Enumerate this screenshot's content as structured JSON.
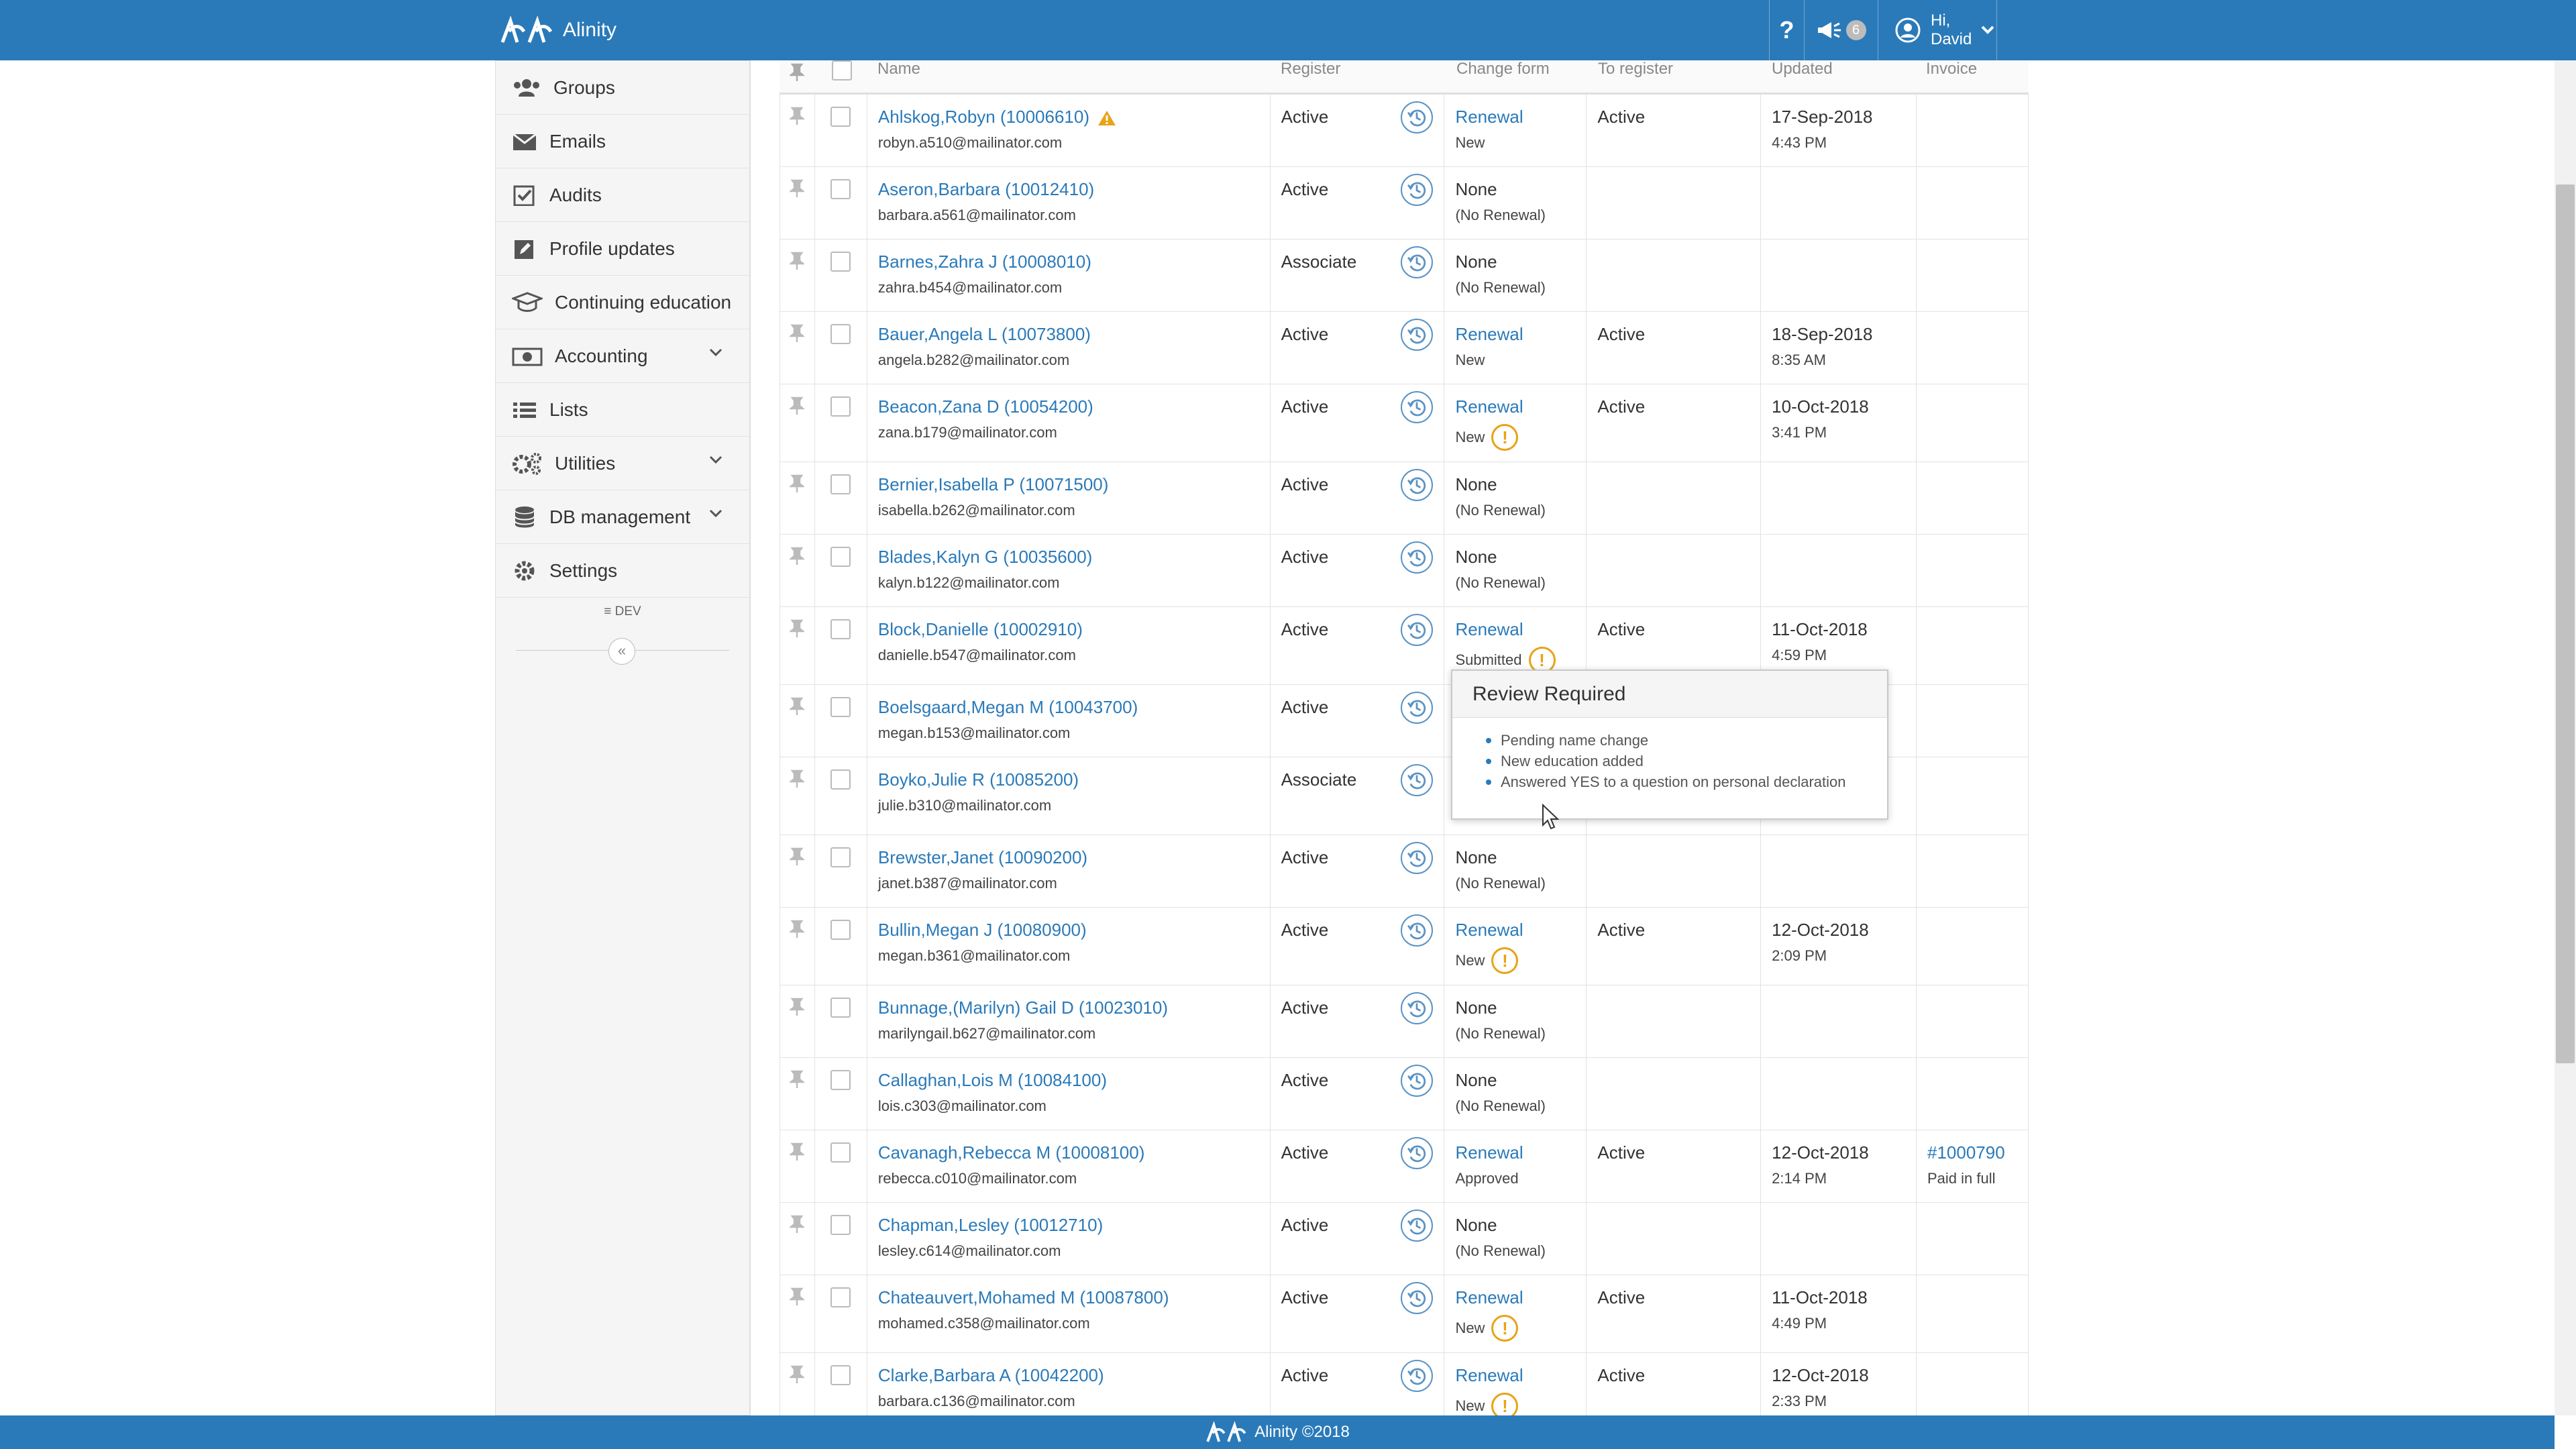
{
  "brand": {
    "name": "Alinity"
  },
  "topbar": {
    "help_label": "?",
    "notification_count": "6",
    "greeting": "Hi,",
    "user_name": "David"
  },
  "sidebar": {
    "items": [
      {
        "label": "Groups",
        "icon": "users-icon"
      },
      {
        "label": "Emails",
        "icon": "envelope-icon"
      },
      {
        "label": "Audits",
        "icon": "check-square-icon"
      },
      {
        "label": "Profile updates",
        "icon": "edit-icon"
      },
      {
        "label": "Continuing education",
        "icon": "graduation-cap-icon"
      },
      {
        "label": "Accounting",
        "icon": "money-icon",
        "expandable": true
      },
      {
        "label": "Lists",
        "icon": "list-icon"
      },
      {
        "label": "Utilities",
        "icon": "cogs-icon",
        "expandable": true
      },
      {
        "label": "DB management",
        "icon": "database-icon",
        "expandable": true
      },
      {
        "label": "Settings",
        "icon": "gear-icon"
      }
    ],
    "env_label": "DEV",
    "collapse_label": "«"
  },
  "grid": {
    "headers": {
      "name": "Name",
      "register": "Register",
      "change_form": "Change form",
      "to_register": "To register",
      "updated": "Updated",
      "invoice": "Invoice"
    },
    "rows": [
      {
        "name": "Ahlskog,Robyn (10006610)",
        "email": "robyn.a510@mailinator.com",
        "register": "Active",
        "form": "Renewal",
        "form_status": "New",
        "to_register": "Active",
        "updated_date": "17-Sep-2018",
        "updated_time": "4:43 PM",
        "invoice": "",
        "invoice_status": "",
        "warning": true
      },
      {
        "name": "Aseron,Barbara (10012410)",
        "email": "barbara.a561@mailinator.com",
        "register": "Active",
        "form": "None",
        "form_status": "(No Renewal)",
        "to_register": "",
        "updated_date": "",
        "updated_time": "",
        "invoice": "",
        "invoice_status": ""
      },
      {
        "name": "Barnes,Zahra J (10008010)",
        "email": "zahra.b454@mailinator.com",
        "register": "Associate",
        "form": "None",
        "form_status": "(No Renewal)",
        "to_register": "",
        "updated_date": "",
        "updated_time": "",
        "invoice": "",
        "invoice_status": ""
      },
      {
        "name": "Bauer,Angela L (10073800)",
        "email": "angela.b282@mailinator.com",
        "register": "Active",
        "form": "Renewal",
        "form_status": "New",
        "to_register": "Active",
        "updated_date": "18-Sep-2018",
        "updated_time": "8:35 AM",
        "invoice": "",
        "invoice_status": ""
      },
      {
        "name": "Beacon,Zana D (10054200)",
        "email": "zana.b179@mailinator.com",
        "register": "Active",
        "form": "Renewal",
        "form_status": "New",
        "to_register": "Active",
        "updated_date": "10-Oct-2018",
        "updated_time": "3:41 PM",
        "invoice": "",
        "invoice_status": "",
        "alert": true
      },
      {
        "name": "Bernier,Isabella P (10071500)",
        "email": "isabella.b262@mailinator.com",
        "register": "Active",
        "form": "None",
        "form_status": "(No Renewal)",
        "to_register": "",
        "updated_date": "",
        "updated_time": "",
        "invoice": "",
        "invoice_status": ""
      },
      {
        "name": "Blades,Kalyn G (10035600)",
        "email": "kalyn.b122@mailinator.com",
        "register": "Active",
        "form": "None",
        "form_status": "(No Renewal)",
        "to_register": "",
        "updated_date": "",
        "updated_time": "",
        "invoice": "",
        "invoice_status": ""
      },
      {
        "name": "Block,Danielle (10002910)",
        "email": "danielle.b547@mailinator.com",
        "register": "Active",
        "form": "Renewal",
        "form_status": "Submitted",
        "to_register": "Active",
        "updated_date": "11-Oct-2018",
        "updated_time": "4:59 PM",
        "invoice": "",
        "invoice_status": "",
        "alert": true
      },
      {
        "name": "Boelsgaard,Megan M (10043700)",
        "email": "megan.b153@mailinator.com",
        "register": "Active",
        "form": "",
        "form_status": "",
        "to_register": "",
        "updated_date": "",
        "updated_time": "",
        "invoice": "",
        "invoice_status": ""
      },
      {
        "name": "Boyko,Julie R (10085200)",
        "email": "julie.b310@mailinator.com",
        "register": "Associate",
        "form": "",
        "form_status": "",
        "to_register": "",
        "updated_date": "",
        "updated_time": "",
        "invoice": "",
        "invoice_status": ""
      },
      {
        "name": "Brewster,Janet (10090200)",
        "email": "janet.b387@mailinator.com",
        "register": "Active",
        "form": "None",
        "form_status": "(No Renewal)",
        "to_register": "",
        "updated_date": "",
        "updated_time": "",
        "invoice": "",
        "invoice_status": ""
      },
      {
        "name": "Bullin,Megan J (10080900)",
        "email": "megan.b361@mailinator.com",
        "register": "Active",
        "form": "Renewal",
        "form_status": "New",
        "to_register": "Active",
        "updated_date": "12-Oct-2018",
        "updated_time": "2:09 PM",
        "invoice": "",
        "invoice_status": "",
        "alert": true
      },
      {
        "name": "Bunnage,(Marilyn) Gail D (10023010)",
        "email": "marilyngail.b627@mailinator.com",
        "register": "Active",
        "form": "None",
        "form_status": "(No Renewal)",
        "to_register": "",
        "updated_date": "",
        "updated_time": "",
        "invoice": "",
        "invoice_status": ""
      },
      {
        "name": "Callaghan,Lois M (10084100)",
        "email": "lois.c303@mailinator.com",
        "register": "Active",
        "form": "None",
        "form_status": "(No Renewal)",
        "to_register": "",
        "updated_date": "",
        "updated_time": "",
        "invoice": "",
        "invoice_status": ""
      },
      {
        "name": "Cavanagh,Rebecca M (10008100)",
        "email": "rebecca.c010@mailinator.com",
        "register": "Active",
        "form": "Renewal",
        "form_status": "Approved",
        "to_register": "Active",
        "updated_date": "12-Oct-2018",
        "updated_time": "2:14 PM",
        "invoice": "#1000790",
        "invoice_status": "Paid in full"
      },
      {
        "name": "Chapman,Lesley (10012710)",
        "email": "lesley.c614@mailinator.com",
        "register": "Active",
        "form": "None",
        "form_status": "(No Renewal)",
        "to_register": "",
        "updated_date": "",
        "updated_time": "",
        "invoice": "",
        "invoice_status": ""
      },
      {
        "name": "Chateauvert,Mohamed M (10087800)",
        "email": "mohamed.c358@mailinator.com",
        "register": "Active",
        "form": "Renewal",
        "form_status": "New",
        "to_register": "Active",
        "updated_date": "11-Oct-2018",
        "updated_time": "4:49 PM",
        "invoice": "",
        "invoice_status": "",
        "alert": true
      },
      {
        "name": "Clarke,Barbara A (10042200)",
        "email": "barbara.c136@mailinator.com",
        "register": "Active",
        "form": "Renewal",
        "form_status": "New",
        "to_register": "Active",
        "updated_date": "12-Oct-2018",
        "updated_time": "2:33 PM",
        "invoice": "",
        "invoice_status": "",
        "alert": true
      }
    ]
  },
  "popover": {
    "title": "Review Required",
    "items": [
      "Pending name change",
      "New education added",
      "Answered YES to a question on personal declaration"
    ]
  },
  "footer": {
    "text": "Alinity ©2018"
  },
  "colors": {
    "primary": "#2a7ab9",
    "warning": "#e8a317"
  }
}
